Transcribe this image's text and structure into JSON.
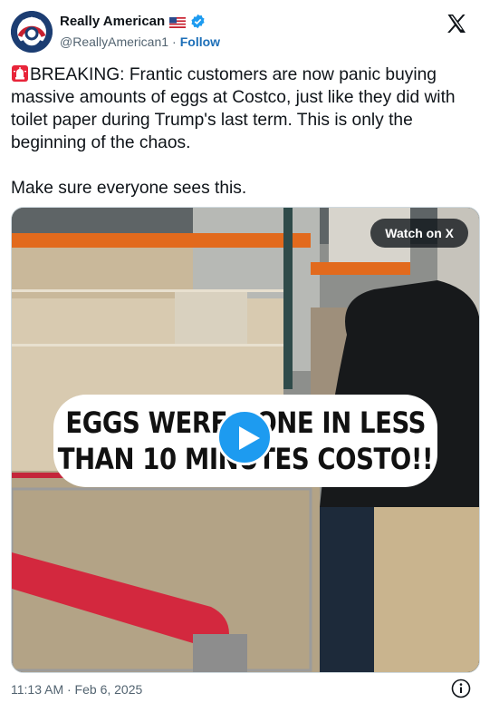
{
  "account": {
    "display_name": "Really American",
    "handle": "@ReallyAmerican1",
    "separator": "·",
    "follow_label": "Follow",
    "verified": true
  },
  "tweet": {
    "text": "BREAKING: Frantic customers are now panic buying massive amounts of eggs at Costco, just like they did with toilet paper during Trump's last term. This is only the beginning of the chaos.\n\nMake sure everyone sees this.",
    "leading_icon": "siren-icon"
  },
  "media": {
    "watch_label": "Watch on X",
    "caption_line_1": "EGGS WERE GONE IN LESS",
    "caption_line_2": "THAN 10 MINUTES COSTO!!",
    "play_icon": "play-icon"
  },
  "footer": {
    "timestamp": "11:13 AM · Feb 6, 2025",
    "info_icon": "info-icon"
  },
  "colors": {
    "accent": "#1d9bf0",
    "follow": "#1d6fb8",
    "text": "#0f1419",
    "muted": "#536471"
  }
}
